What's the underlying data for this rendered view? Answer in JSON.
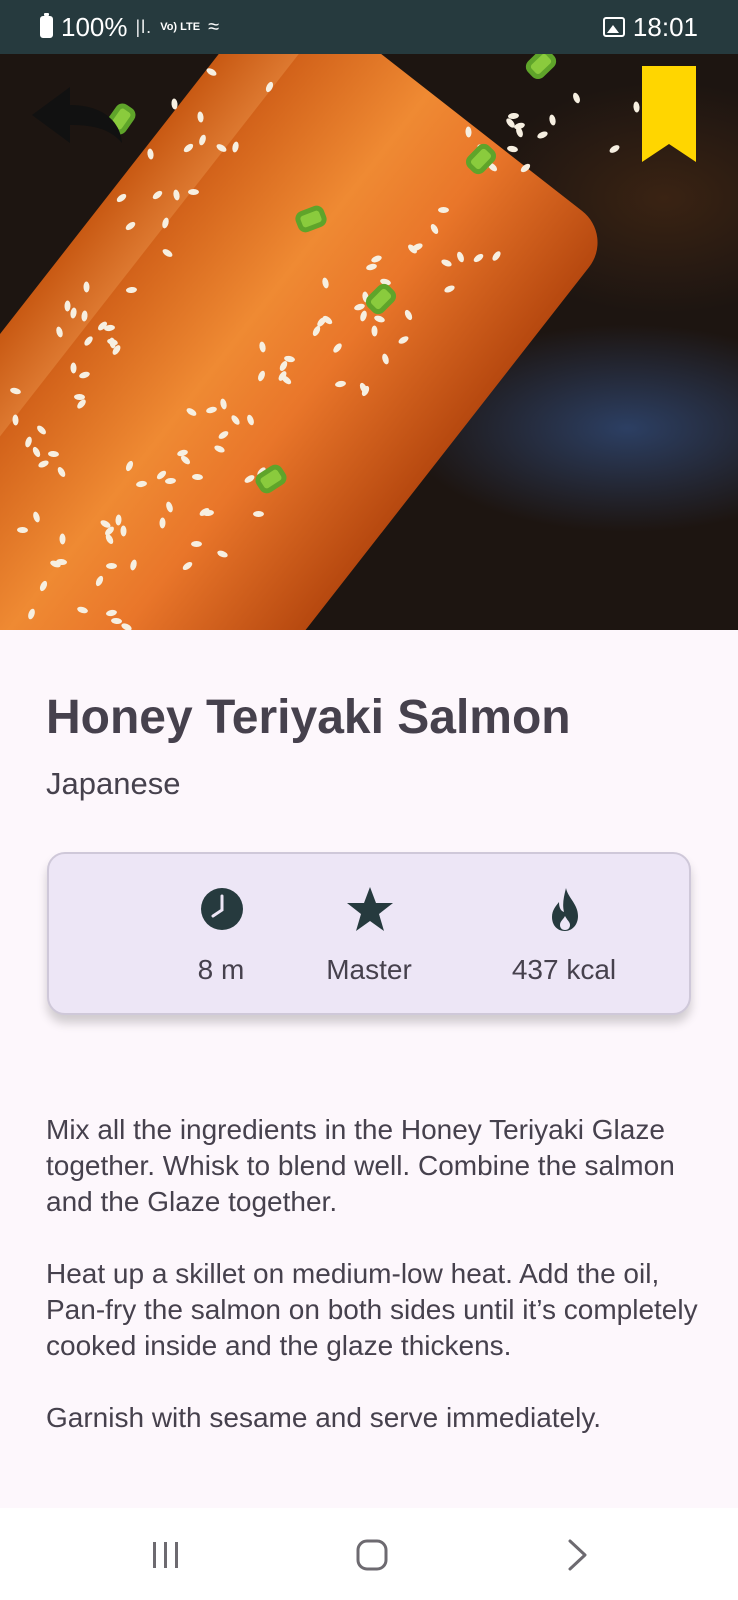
{
  "status_bar": {
    "battery": "100%",
    "signal": "Vo) LTE",
    "time": "18:01"
  },
  "colors": {
    "status_bar_bg": "#263a3e",
    "bookmark": "#ffd600",
    "page_bg": "#fdf7fc",
    "card_bg": "#ede6f6",
    "text": "#46414d",
    "icon": "#263a3e"
  },
  "recipe": {
    "title": "Honey Teriyaki Salmon",
    "cuisine": "Japanese",
    "image_icon": "photo-salmon",
    "stats": {
      "time": "8 m",
      "difficulty": "Master",
      "calories": "437 kcal"
    },
    "instructions": [
      "Mix all the ingredients in the Honey Teriyaki Glaze together. Whisk to blend well. Combine the salmon and the Glaze together.",
      "Heat up a skillet on medium-low heat. Add the oil, Pan-fry the salmon on both sides until it’s completely cooked inside and the glaze thickens.",
      "Garnish with sesame and serve immediately."
    ]
  },
  "icons": {
    "back": "back-arrow-icon",
    "bookmark": "bookmark-icon",
    "time": "clock-icon",
    "difficulty": "star-icon",
    "calories": "flame-icon"
  }
}
